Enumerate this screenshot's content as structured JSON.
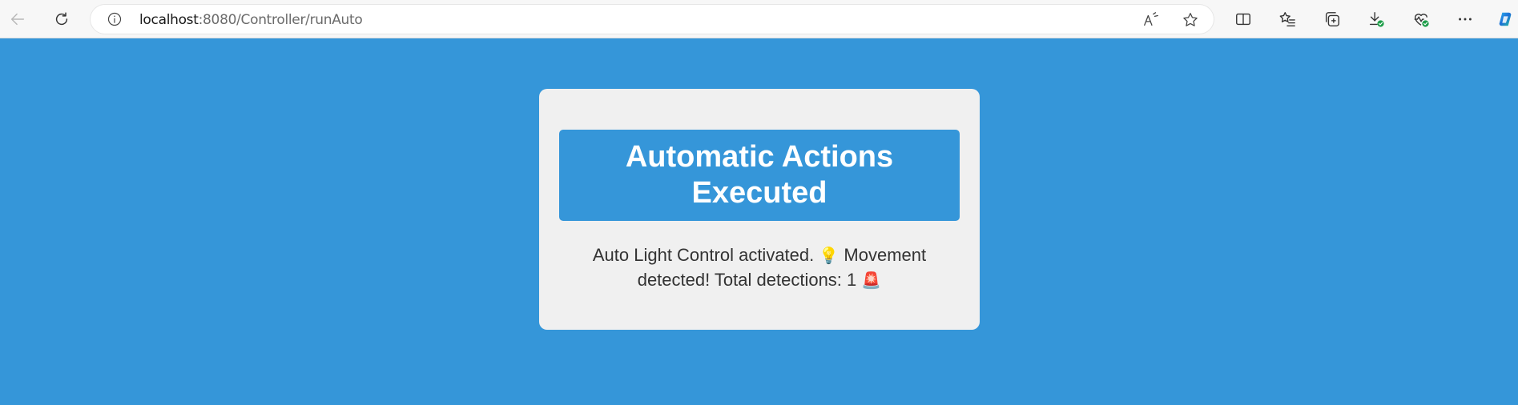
{
  "browser": {
    "url_host": "localhost",
    "url_path": ":8080/Controller/runAuto",
    "toolbar_icons": [
      "back-icon",
      "reload-icon",
      "info-icon",
      "read-aloud-icon",
      "favorite-star-icon",
      "split-screen-icon",
      "favorites-icon",
      "collections-icon",
      "downloads-icon",
      "browser-essentials-icon",
      "more-icon",
      "copilot-icon"
    ]
  },
  "page": {
    "background_color": "#3596d9",
    "card_color": "#f0f0f0",
    "title": "Automatic Actions Executed",
    "message_part1": "Auto Light Control activated.",
    "emoji_bulb": "💡",
    "message_part2": "Movement detected! Total detections: 1",
    "emoji_siren": "🚨"
  }
}
